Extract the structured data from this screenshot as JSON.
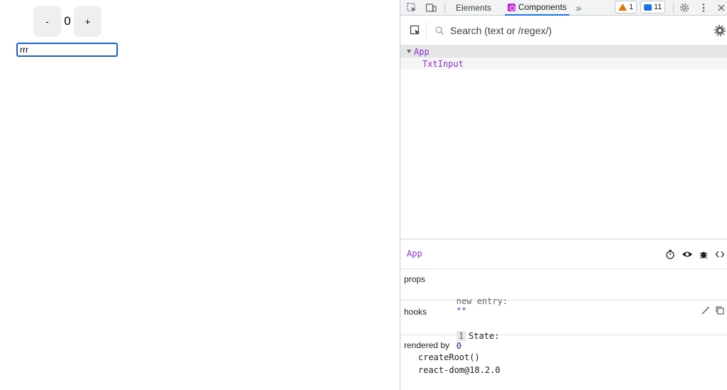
{
  "app": {
    "minus_label": "-",
    "count": "0",
    "plus_label": "+",
    "text_value": "rrr"
  },
  "devtools": {
    "tabs": [
      {
        "label": "Elements",
        "active": false
      },
      {
        "label": "Components",
        "active": true
      }
    ],
    "more_tabs": "»",
    "warning_count": "1",
    "message_count": "11",
    "search": {
      "placeholder": "Search (text or /regex/)",
      "value": ""
    },
    "tree": [
      {
        "name": "App",
        "expanded": true
      },
      {
        "name": "TxtInput",
        "expanded": false
      }
    ],
    "inspector": {
      "selected": "App",
      "props_title": "props",
      "props": [
        {
          "key": "new entry:",
          "value": "\"\""
        }
      ],
      "hooks_title": "hooks",
      "hooks": [
        {
          "index": "1",
          "label": "State:",
          "value": "0"
        }
      ],
      "rendered_by_title": "rendered by",
      "rendered_by": [
        "createRoot()",
        "react-dom@18.2.0"
      ]
    },
    "colors": {
      "accent": "#1a73e8",
      "component_name": "#8b2fc9",
      "value": "#1a1aa6",
      "warning": "#e37400"
    },
    "icons": [
      "inspect-element-icon",
      "device-toolbar-icon",
      "warning-icon",
      "message-icon",
      "settings-icon",
      "kebab-menu-icon",
      "close-icon",
      "select-component-icon",
      "search-icon",
      "timer-icon",
      "eye-icon",
      "bug-icon",
      "code-icon",
      "magic-wand-icon",
      "copy-icon"
    ]
  }
}
